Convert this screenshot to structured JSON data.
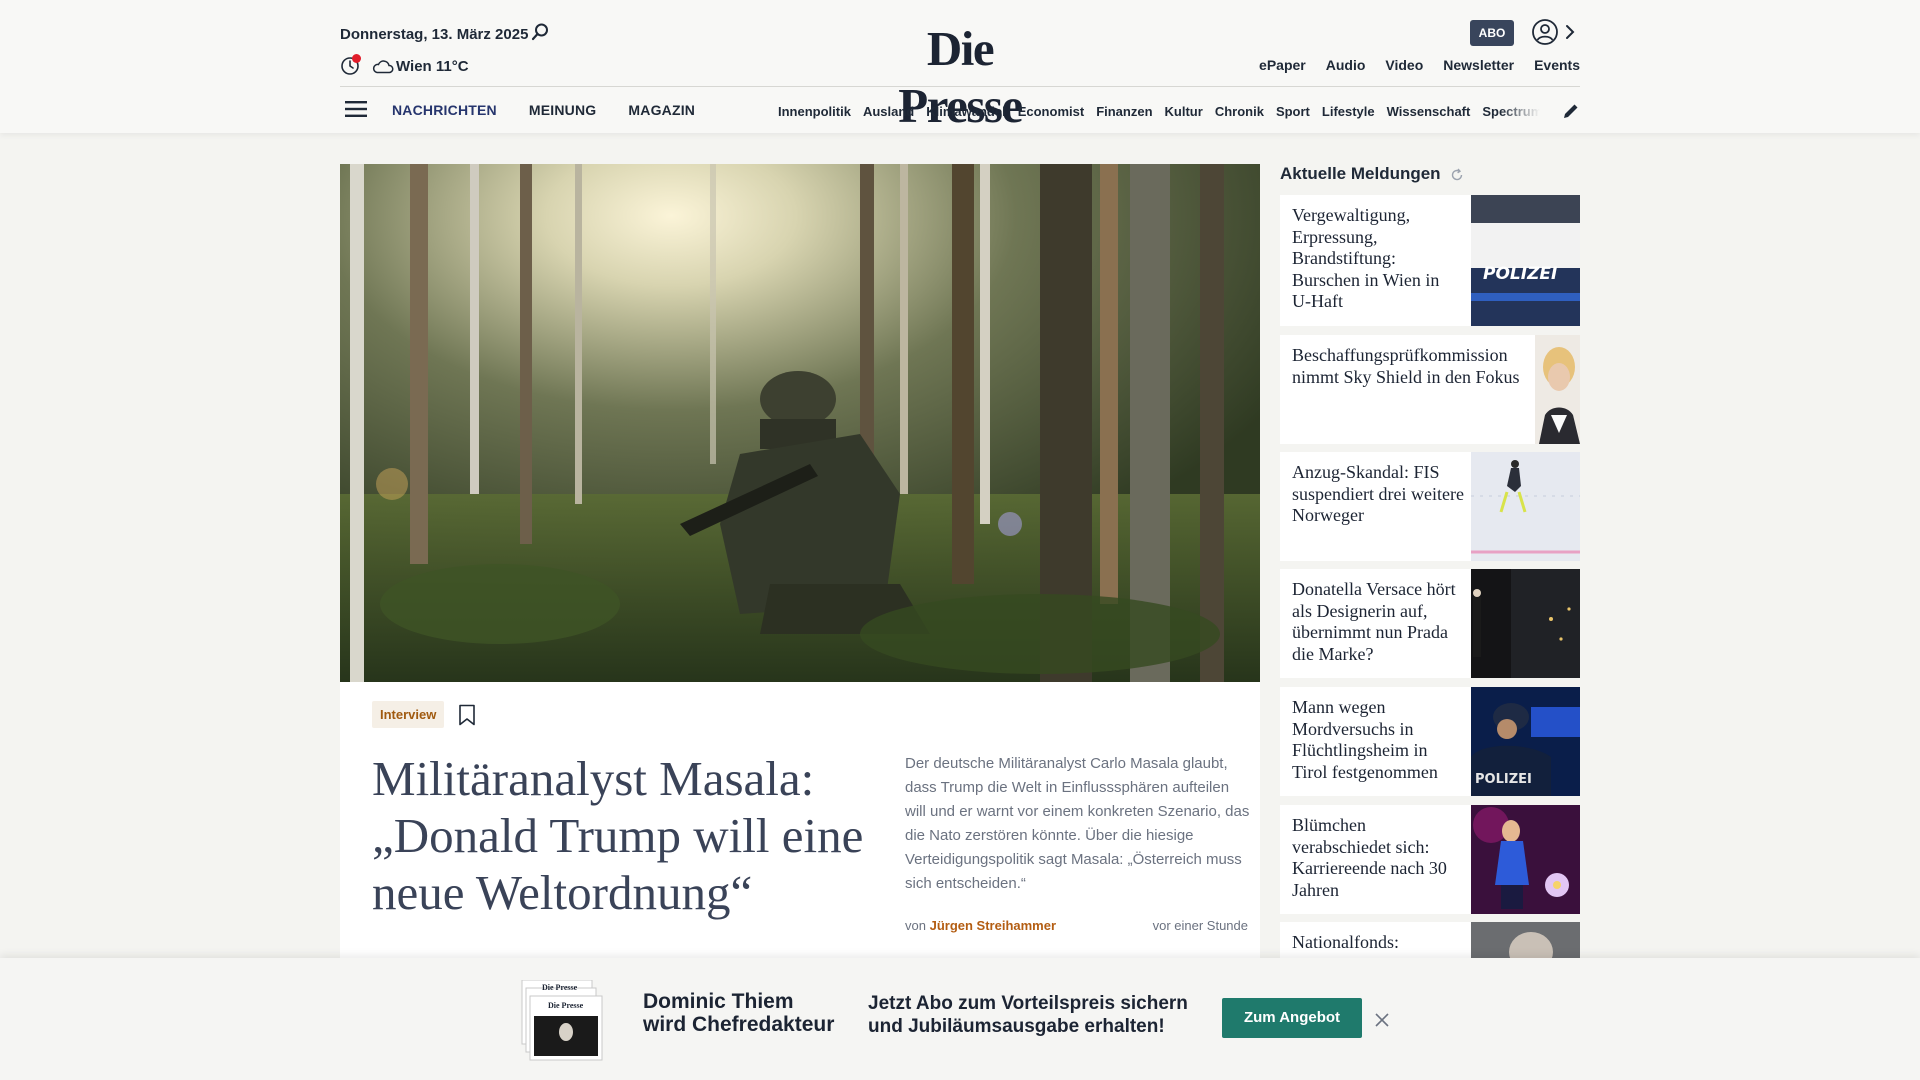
{
  "header": {
    "date": "Donnerstag, 13. März 2025",
    "weather": "Wien 11°C",
    "logo": "Die Presse",
    "abo_label": "ABO",
    "top_links": [
      "ePaper",
      "Audio",
      "Video",
      "Newsletter",
      "Events"
    ],
    "main_nav": [
      "NACHRICHTEN",
      "MEINUNG",
      "MAGAZIN"
    ],
    "sub_nav": [
      "Innenpolitik",
      "Ausland",
      "Klimawandel",
      "Economist",
      "Finanzen",
      "Kultur",
      "Chronik",
      "Sport",
      "Lifestyle",
      "Wissenschaft",
      "Spectrum"
    ]
  },
  "hero": {
    "tag": "Interview",
    "headline": "Militäranalyst Masala: „Donald Trump will eine neue Weltordnung“",
    "teaser": "Der deutsche Militäranalyst Carlo Masala glaubt, dass Trump die Welt in Einflusssphären aufteilen will und er warnt vor einem konkreten Szenario, das die Nato zerstören könnte. Über die hiesige Verteidigungspolitik sagt Masala: „Österreich muss sich entscheiden.“",
    "byline_prefix": "von",
    "author": "Jürgen Streihammer",
    "time": "vor einer Stunde"
  },
  "sidebar": {
    "title": "Aktuelle Meldungen",
    "items": [
      {
        "title": "Vergewaltigung, Erpressung, Brandstiftung: Burschen in Wien in U-Haft",
        "thumb_text": "POLIZEI"
      },
      {
        "title": "Beschaffungsprüfkommission nimmt Sky Shield in den Fokus"
      },
      {
        "title": "Anzug-Skandal: FIS suspendiert drei weitere Norweger"
      },
      {
        "title": "Donatella Versace hört als Designerin auf, übernimmt nun Prada die Marke?"
      },
      {
        "title": "Mann wegen Mordversuchs in Flüchtlingsheim in Tirol festgenommen",
        "thumb_text": "POLIZEI"
      },
      {
        "title": "Blümchen verabschiedet sich: Karriereende nach 30 Jahren"
      },
      {
        "title": "Nationalfonds:"
      }
    ]
  },
  "promo": {
    "heading_line1": "Dominic Thiem",
    "heading_line2": "wird Chefredakteur",
    "text_line1": "Jetzt Abo zum Vorteilspreis sichern",
    "text_line2": "und Jubiläumsausgabe erhalten!",
    "button": "Zum Angebot",
    "paper_logo": "Die Presse"
  },
  "colors": {
    "navy": "#1c2433",
    "nav_active": "#26356d",
    "tag_text": "#b35d12",
    "cta_green": "#1f7a6c",
    "abo_badge": "#39455c"
  }
}
